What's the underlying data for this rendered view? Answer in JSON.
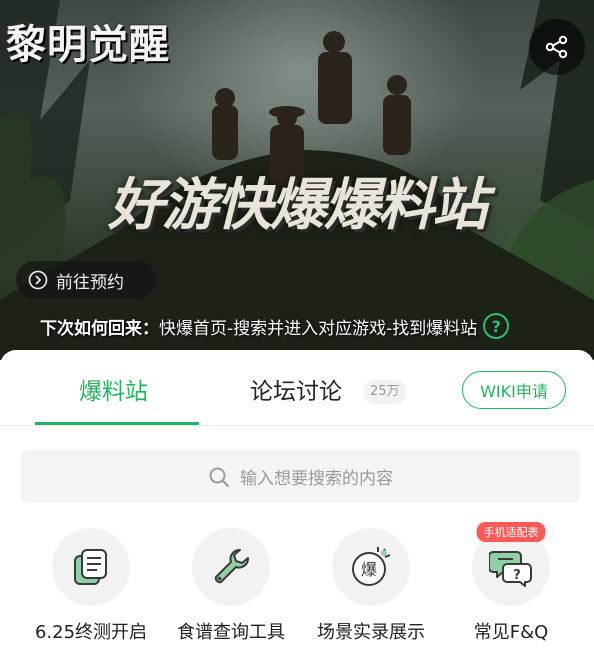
{
  "hero": {
    "game_logo": "黎明觉醒",
    "banner_title": "好游快爆爆料站",
    "reserve_label": "前往预约",
    "return_tip_strong": "下次如何回来：",
    "return_tip_text": "快爆首页-搜索并进入对应游戏-找到爆料站",
    "help_glyph": "?"
  },
  "tabs": {
    "active": "爆料站",
    "forum": "论坛讨论",
    "forum_count": "25万",
    "wiki_button": "WIKI申请"
  },
  "search": {
    "placeholder": "输入想要搜索的内容"
  },
  "tools": [
    {
      "label": "6.25终测开启",
      "icon": "document-stack-icon"
    },
    {
      "label": "食谱查询工具",
      "icon": "wrench-icon"
    },
    {
      "label": "场景实录展示",
      "icon": "burst-character-icon",
      "glyph": "爆"
    },
    {
      "label": "常见F&Q",
      "icon": "chat-question-icon",
      "tag": "手机适配表",
      "glyph": "?"
    }
  ],
  "colors": {
    "accent": "#21b35e",
    "icon_green": "#8fd1a4",
    "tag_red": "#ff5a5a"
  }
}
